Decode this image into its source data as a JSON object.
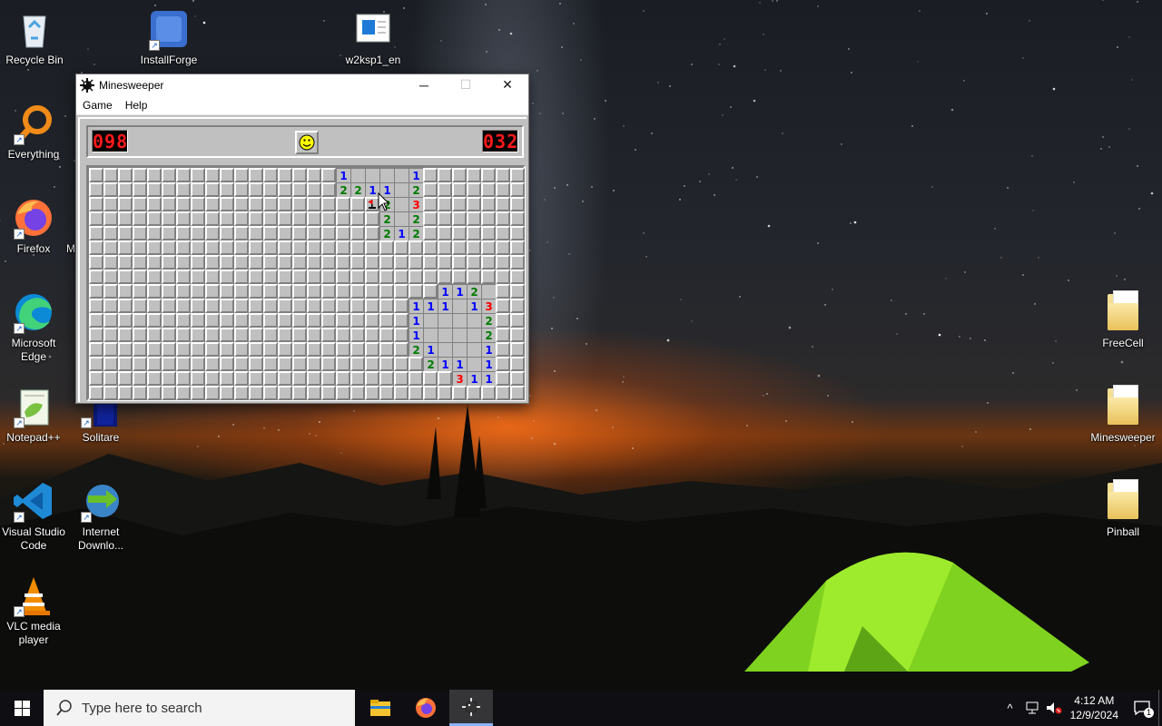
{
  "desktop": {
    "icons_left": [
      {
        "label": "Recycle Bin",
        "icon": "recycle-bin-icon"
      },
      {
        "label": "InstallForge",
        "icon": "installforge-icon"
      },
      {
        "label": "w2ksp1_en",
        "icon": "document-icon"
      },
      {
        "label": "Everything",
        "icon": "everything-search-icon"
      },
      {
        "label": "Firefox",
        "icon": "firefox-icon"
      },
      {
        "label": "M",
        "icon": "partially-hidden-icon"
      },
      {
        "label": "Microsoft Edge",
        "icon": "edge-icon"
      },
      {
        "label": "Notepad++",
        "icon": "notepadpp-icon"
      },
      {
        "label": "Solitare",
        "icon": "solitaire-icon"
      },
      {
        "label": "Visual Studio Code",
        "icon": "vscode-icon"
      },
      {
        "label": "Internet Downlo...",
        "icon": "internet-download-manager-icon"
      },
      {
        "label": "VLC media player",
        "icon": "vlc-icon"
      }
    ],
    "icons_right": [
      {
        "label": "FreeCell",
        "icon": "folder-icon"
      },
      {
        "label": "Minesweeper",
        "icon": "folder-icon"
      },
      {
        "label": "Pinball",
        "icon": "folder-icon"
      }
    ]
  },
  "window": {
    "title": "Minesweeper",
    "controls": {
      "minimize": "─",
      "maximize": "☐",
      "close": "✕"
    },
    "menu": [
      "Game",
      "Help"
    ],
    "mine_counter": "098",
    "timer": "032",
    "smiley": "smiley-face-icon",
    "board": {
      "cols": 30,
      "rows": 16,
      "opened_ranges": [
        [
          0,
          17,
          21
        ],
        [
          1,
          17,
          21
        ],
        [
          2,
          19,
          21
        ],
        [
          3,
          20,
          21
        ],
        [
          4,
          20,
          22
        ],
        [
          8,
          24,
          27
        ],
        [
          9,
          23,
          27
        ],
        [
          10,
          23,
          27
        ],
        [
          11,
          23,
          27
        ],
        [
          12,
          23,
          27
        ],
        [
          13,
          24,
          27
        ],
        [
          14,
          26,
          27
        ]
      ],
      "numbers": [
        [
          0,
          17,
          1
        ],
        [
          0,
          22,
          1
        ],
        [
          1,
          17,
          2
        ],
        [
          1,
          18,
          2
        ],
        [
          1,
          19,
          1
        ],
        [
          1,
          20,
          1
        ],
        [
          1,
          22,
          2
        ],
        [
          2,
          19,
          1
        ],
        [
          2,
          20,
          2
        ],
        [
          2,
          22,
          3
        ],
        [
          3,
          20,
          2
        ],
        [
          3,
          22,
          2
        ],
        [
          4,
          20,
          2
        ],
        [
          4,
          21,
          1
        ],
        [
          4,
          22,
          2
        ],
        [
          8,
          24,
          1
        ],
        [
          8,
          25,
          1
        ],
        [
          8,
          26,
          2
        ],
        [
          9,
          22,
          1
        ],
        [
          9,
          23,
          1
        ],
        [
          9,
          24,
          1
        ],
        [
          9,
          26,
          1
        ],
        [
          9,
          27,
          3
        ],
        [
          10,
          22,
          1
        ],
        [
          10,
          27,
          2
        ],
        [
          11,
          22,
          1
        ],
        [
          11,
          27,
          2
        ],
        [
          12,
          22,
          2
        ],
        [
          12,
          23,
          1
        ],
        [
          12,
          27,
          1
        ],
        [
          13,
          23,
          2
        ],
        [
          13,
          24,
          1
        ],
        [
          13,
          25,
          1
        ],
        [
          13,
          27,
          1
        ],
        [
          14,
          25,
          3
        ],
        [
          14,
          26,
          1
        ],
        [
          14,
          27,
          1
        ]
      ],
      "flags": [
        [
          2,
          19
        ]
      ]
    }
  },
  "taskbar": {
    "search_placeholder": "Type here to search",
    "pinned": [
      "file-explorer-icon",
      "firefox-icon",
      "minesweeper-icon"
    ],
    "active_app": "minesweeper-icon",
    "time": "4:12 AM",
    "date": "12/9/2024",
    "notification_count": "1"
  },
  "colors": {
    "number_1": "#0000ff",
    "number_2": "#007b00",
    "number_3": "#ff0000",
    "lcd": "#ff1a1a"
  }
}
